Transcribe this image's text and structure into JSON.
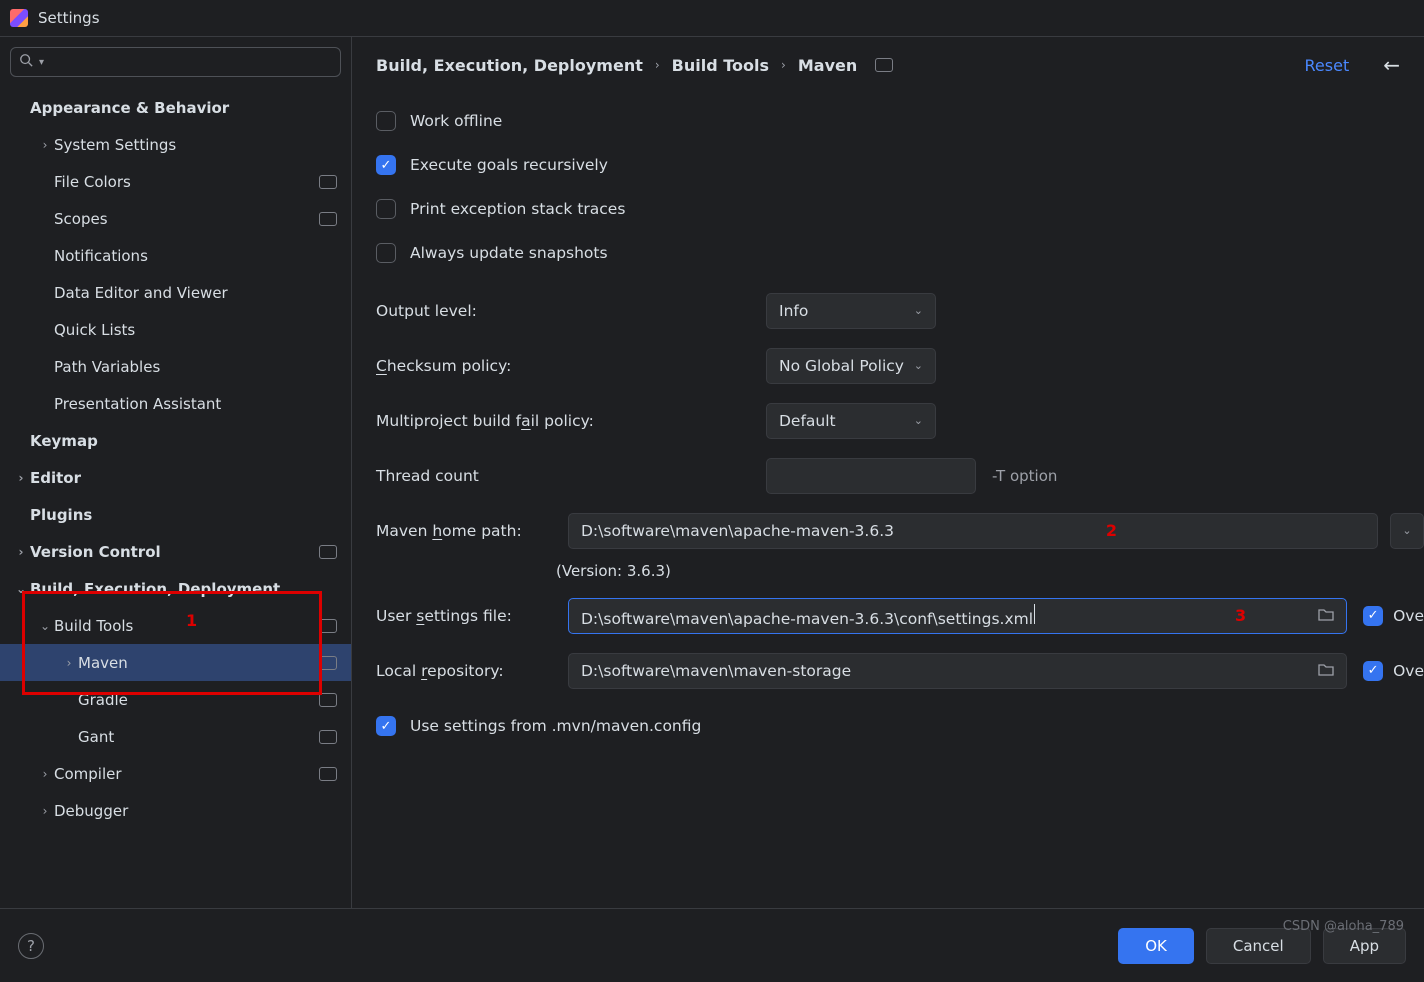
{
  "window": {
    "title": "Settings"
  },
  "search": {
    "placeholder": ""
  },
  "tree": {
    "items": [
      {
        "label": "Appearance & Behavior",
        "bold": true,
        "level": 0,
        "arrow": "",
        "tag": false
      },
      {
        "label": "System Settings",
        "bold": false,
        "level": 1,
        "arrow": ">",
        "tag": false
      },
      {
        "label": "File Colors",
        "bold": false,
        "level": 1,
        "arrow": "",
        "tag": true
      },
      {
        "label": "Scopes",
        "bold": false,
        "level": 1,
        "arrow": "",
        "tag": true
      },
      {
        "label": "Notifications",
        "bold": false,
        "level": 1,
        "arrow": "",
        "tag": false
      },
      {
        "label": "Data Editor and Viewer",
        "bold": false,
        "level": 1,
        "arrow": "",
        "tag": false
      },
      {
        "label": "Quick Lists",
        "bold": false,
        "level": 1,
        "arrow": "",
        "tag": false
      },
      {
        "label": "Path Variables",
        "bold": false,
        "level": 1,
        "arrow": "",
        "tag": false
      },
      {
        "label": "Presentation Assistant",
        "bold": false,
        "level": 1,
        "arrow": "",
        "tag": false
      },
      {
        "label": "Keymap",
        "bold": true,
        "level": 0,
        "arrow": "",
        "tag": false
      },
      {
        "label": "Editor",
        "bold": true,
        "level": 0,
        "arrow": ">",
        "tag": false
      },
      {
        "label": "Plugins",
        "bold": true,
        "level": 0,
        "arrow": "",
        "tag": false
      },
      {
        "label": "Version Control",
        "bold": true,
        "level": 0,
        "arrow": ">",
        "tag": true
      },
      {
        "label": "Build, Execution, Deployment",
        "bold": true,
        "level": 0,
        "arrow": "v",
        "tag": false
      },
      {
        "label": "Build Tools",
        "bold": false,
        "level": 1,
        "arrow": "v",
        "tag": true
      },
      {
        "label": "Maven",
        "bold": false,
        "level": 2,
        "arrow": ">",
        "tag": true,
        "selected": true
      },
      {
        "label": "Gradle",
        "bold": false,
        "level": 2,
        "arrow": "",
        "tag": true
      },
      {
        "label": "Gant",
        "bold": false,
        "level": 2,
        "arrow": "",
        "tag": true
      },
      {
        "label": "Compiler",
        "bold": false,
        "level": 1,
        "arrow": ">",
        "tag": true
      },
      {
        "label": "Debugger",
        "bold": false,
        "level": 1,
        "arrow": ">",
        "tag": false
      }
    ]
  },
  "annotations": {
    "box1_num": "1",
    "num2": "2",
    "num3": "3"
  },
  "breadcrumb": {
    "a": "Build, Execution, Deployment",
    "b": "Build Tools",
    "c": "Maven"
  },
  "header": {
    "reset": "Reset"
  },
  "checks": {
    "work_offline": {
      "label": "Work offline",
      "checked": false
    },
    "exec_recursive": {
      "label": "Execute goals recursively",
      "checked": true
    },
    "print_exc": {
      "label": "Print exception stack traces",
      "checked": false
    },
    "always_update": {
      "label": "Always update snapshots",
      "checked": false
    }
  },
  "fields": {
    "output_level": {
      "label": "Output level:",
      "value": "Info"
    },
    "checksum": {
      "label_pre": "",
      "u": "C",
      "label_post": "hecksum policy:",
      "value": "No Global Policy"
    },
    "fail_policy": {
      "label_pre": "Multiproject build f",
      "u": "a",
      "label_post": "il policy:",
      "value": "Default"
    },
    "thread_count": {
      "label": "Thread count",
      "value": "",
      "hint": "-T option"
    },
    "home_path": {
      "label_pre": "Maven ",
      "u": "h",
      "label_post": "ome path:",
      "value": "D:\\software\\maven\\apache-maven-3.6.3"
    },
    "version_line": "(Version: 3.6.3)",
    "user_settings": {
      "label_pre": "User ",
      "u": "s",
      "label_post": "ettings file:",
      "value": "D:\\software\\maven\\apache-maven-3.6.3\\conf\\settings.xml"
    },
    "local_repo": {
      "label_pre": "Local ",
      "u": "r",
      "label_post": "epository:",
      "value": "D:\\software\\maven\\maven-storage"
    },
    "override1": {
      "label": "Ove",
      "checked": true
    },
    "override2": {
      "label": "Ove",
      "checked": true
    },
    "use_mvn_config": {
      "label": "Use settings from .mvn/maven.config",
      "checked": true
    }
  },
  "footer": {
    "ok": "OK",
    "cancel": "Cancel",
    "apply": "App"
  },
  "watermark": "CSDN @aloha_789"
}
